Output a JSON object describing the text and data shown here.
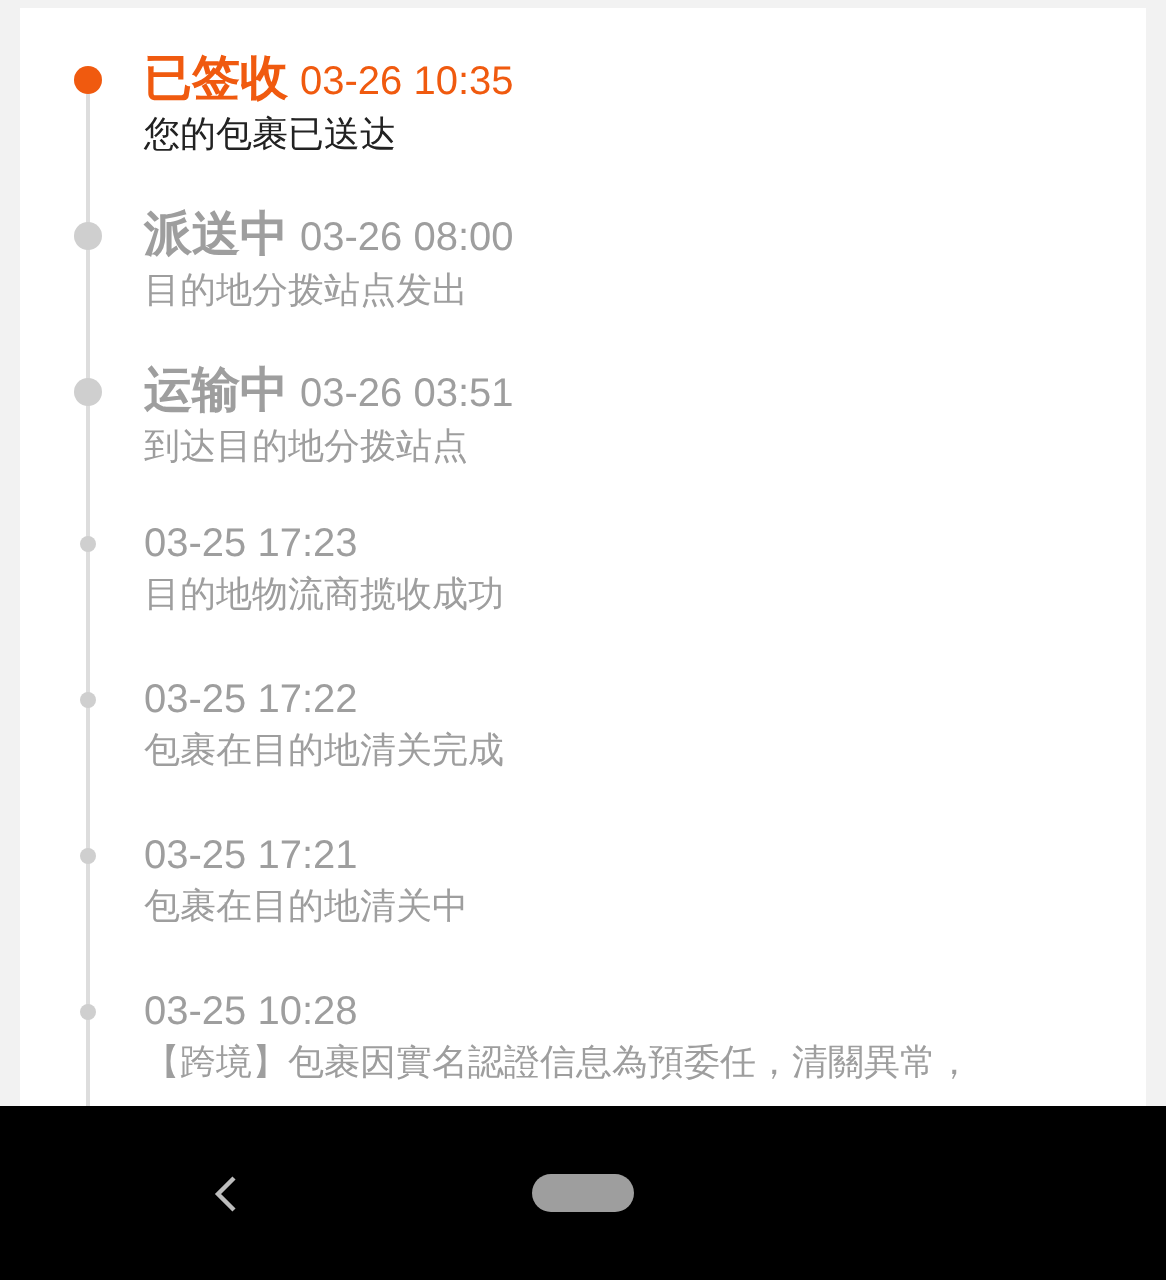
{
  "events": [
    {
      "kind": "major",
      "active": true,
      "status": "已签收",
      "time": "03-26 10:35",
      "description": "您的包裹已送达"
    },
    {
      "kind": "major",
      "active": false,
      "status": "派送中",
      "time": "03-26 08:00",
      "description": "目的地分拨站点发出"
    },
    {
      "kind": "major",
      "active": false,
      "status": "运输中",
      "time": "03-26 03:51",
      "description": "到达目的地分拨站点"
    },
    {
      "kind": "minor",
      "active": false,
      "time": "03-25 17:23",
      "description": "目的地物流商揽收成功"
    },
    {
      "kind": "minor",
      "active": false,
      "time": "03-25 17:22",
      "description": "包裹在目的地清关完成"
    },
    {
      "kind": "minor",
      "active": false,
      "time": "03-25 17:21",
      "description": "包裹在目的地清关中"
    },
    {
      "kind": "minor",
      "active": false,
      "time": "03-25 10:28",
      "description": "【跨境】包裹因實名認證信息為預委任，清關異常，"
    }
  ]
}
